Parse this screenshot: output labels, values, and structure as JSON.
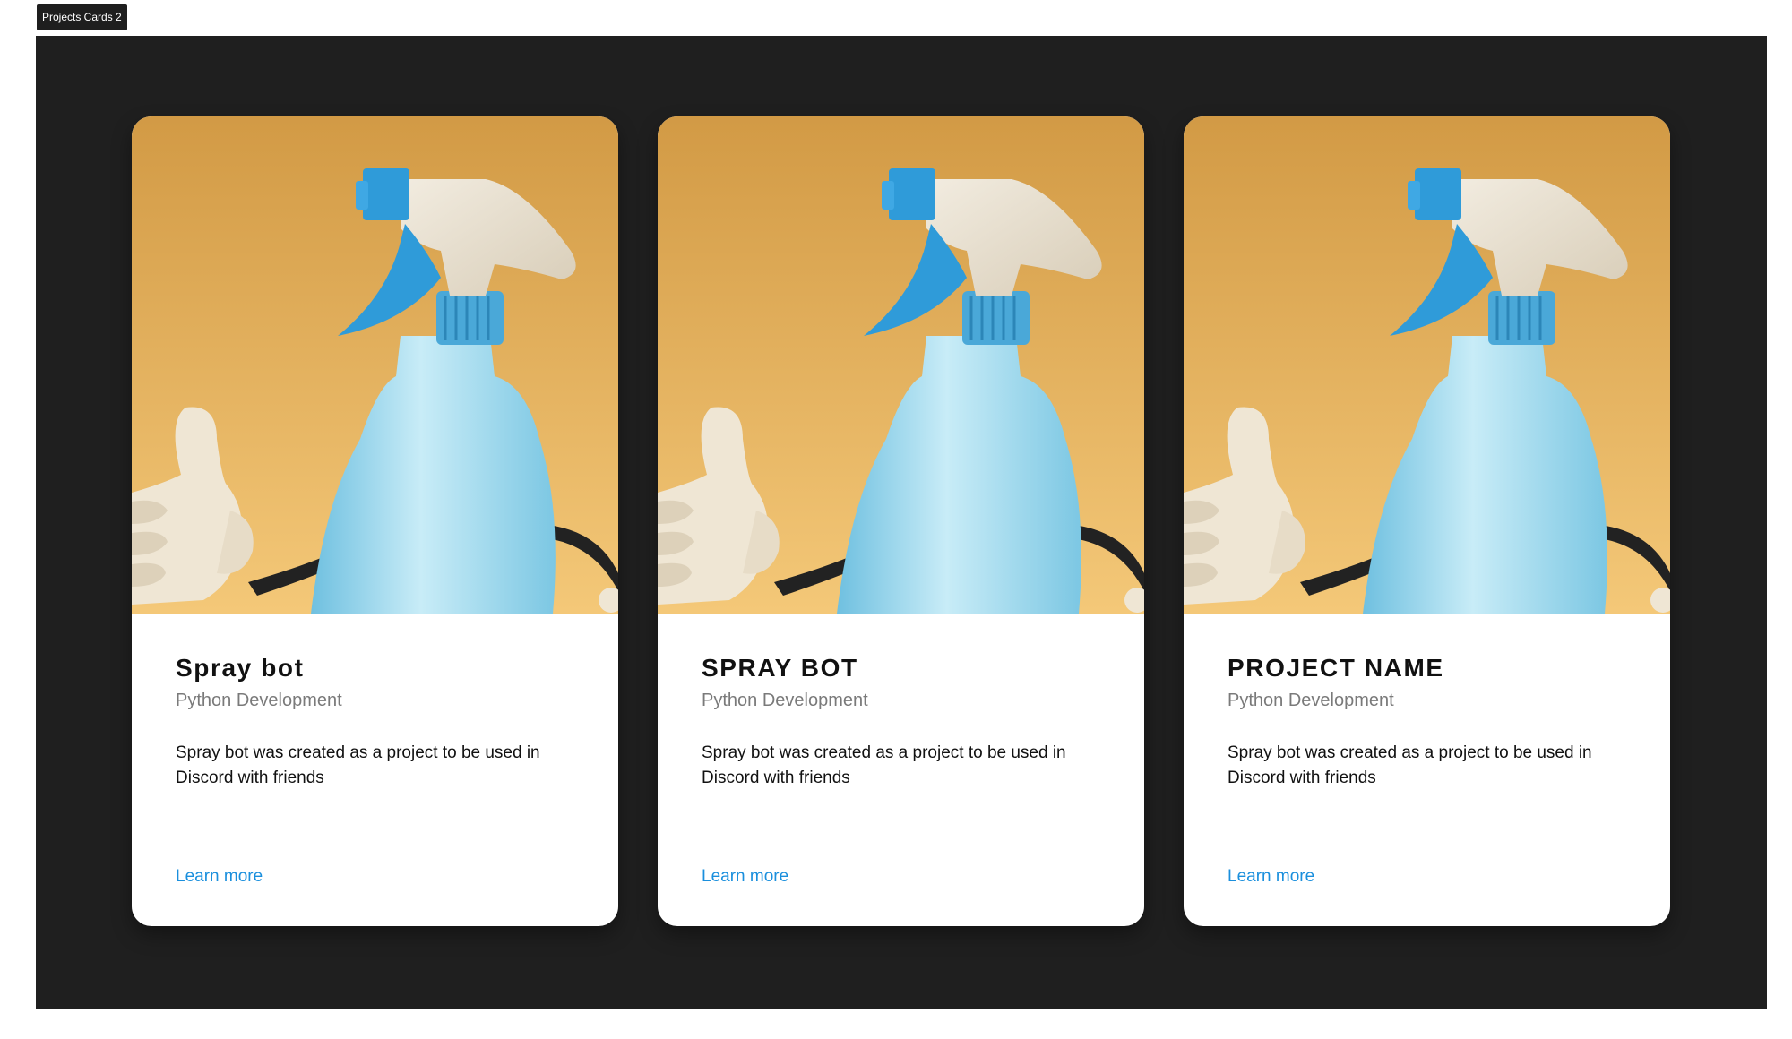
{
  "frame": {
    "label": "Projects Cards 2"
  },
  "colors": {
    "frame_bg": "#1f1f1f",
    "card_bg": "#ffffff",
    "link": "#1a8fdd",
    "subtitle": "#7a7a7a",
    "image_bg_top": "#d29a45",
    "image_bg_bottom": "#f4c878",
    "bottle": "#9fd8ee",
    "trigger_blue": "#2f9bd9"
  },
  "cards": [
    {
      "title": "Spray bot",
      "subtitle": "Python Development",
      "description": "Spray bot was created as a project to be used in Discord with friends",
      "link_label": "Learn more",
      "image_icon": "spray-bottle-thumbs-up-illustration"
    },
    {
      "title": "SPRAY BOT",
      "subtitle": "Python Development",
      "description": "Spray bot was created as a project to be used in Discord with friends",
      "link_label": "Learn more",
      "image_icon": "spray-bottle-thumbs-up-illustration"
    },
    {
      "title": "PROJECT NAME",
      "subtitle": "Python Development",
      "description": "Spray bot was created as a project to be used in Discord with friends",
      "link_label": "Learn more",
      "image_icon": "spray-bottle-thumbs-up-illustration"
    }
  ]
}
